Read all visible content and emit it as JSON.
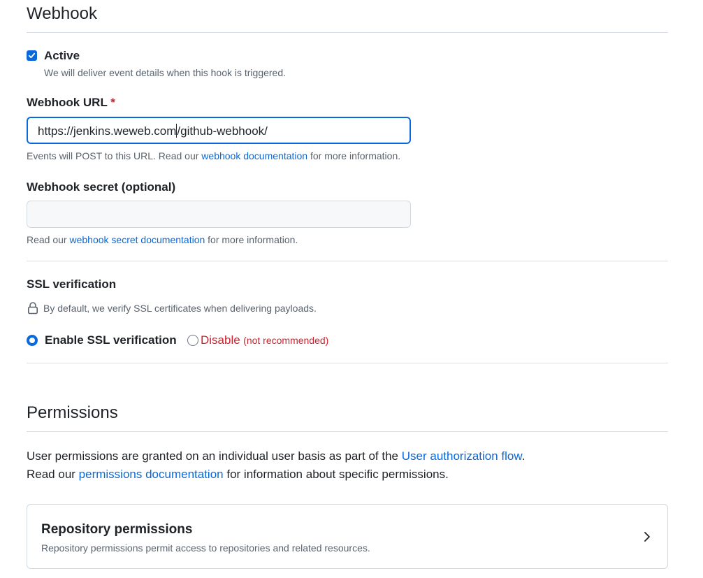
{
  "webhook": {
    "heading": "Webhook",
    "active": {
      "label": "Active",
      "checked": true,
      "description": "We will deliver event details when this hook is triggered."
    },
    "url_field": {
      "label": "Webhook URL",
      "required_marker": "*",
      "value_before_caret": "https://jenkins.weweb.com",
      "value_after_caret": "/github-webhook/",
      "note_prefix": "Events will POST to this URL. Read our",
      "note_link": "webhook documentation",
      "note_suffix": "for more information."
    },
    "secret_field": {
      "label": "Webhook secret (optional)",
      "value": "",
      "note_prefix": "Read our",
      "note_link": "webhook secret documentation",
      "note_suffix": "for more information."
    }
  },
  "ssl": {
    "heading": "SSL verification",
    "icon": "lock-icon",
    "description": "By default, we verify SSL certificates when delivering payloads.",
    "options": {
      "enable_label": "Enable SSL verification",
      "disable_label": "Disable",
      "disable_hint": "(not recommended)",
      "selected": "enable"
    }
  },
  "permissions": {
    "heading": "Permissions",
    "line1_prefix": "User permissions are granted on an individual user basis as part of the",
    "line1_link": "User authorization flow",
    "line1_suffix": ".",
    "line2_prefix": "Read our",
    "line2_link": "permissions documentation",
    "line2_suffix": "for information about specific permissions.",
    "repository_card": {
      "title": "Repository permissions",
      "description": "Repository permissions permit access to repositories and related resources.",
      "icon": "chevron-right-icon"
    }
  },
  "colors": {
    "accent": "#0969da",
    "danger": "#cf222e",
    "muted_text": "#59636e",
    "border": "#d1d9e0"
  }
}
